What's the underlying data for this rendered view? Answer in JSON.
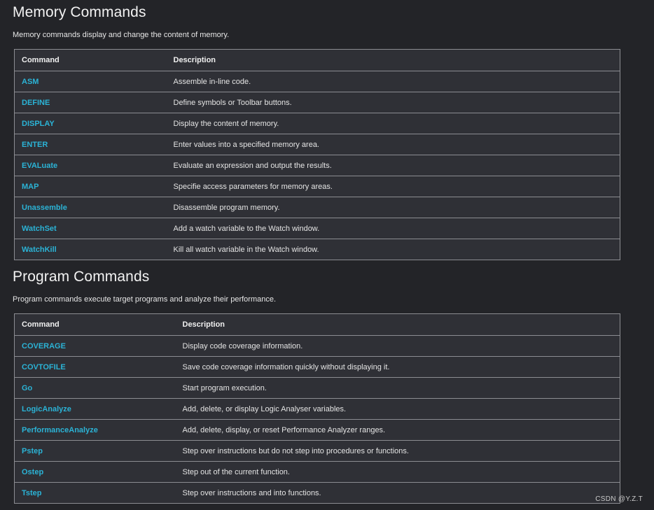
{
  "memory": {
    "title": "Memory Commands",
    "intro": "Memory commands display and change the content of memory.",
    "headers": {
      "command": "Command",
      "description": "Description"
    },
    "rows": [
      {
        "command": "ASM",
        "description": "Assemble in-line code."
      },
      {
        "command": "DEFINE",
        "description": "Define symbols or Toolbar buttons."
      },
      {
        "command": "DISPLAY",
        "description": "Display the content of memory."
      },
      {
        "command": "ENTER",
        "description": "Enter values into a specified memory area."
      },
      {
        "command": "EVALuate",
        "description": "Evaluate an expression and output the results."
      },
      {
        "command": "MAP",
        "description": "Specifie access parameters for memory areas."
      },
      {
        "command": "Unassemble",
        "description": "Disassemble program memory."
      },
      {
        "command": "WatchSet",
        "description": "Add a watch variable to the Watch window."
      },
      {
        "command": "WatchKill",
        "description": "Kill all watch variable in the Watch window."
      }
    ]
  },
  "program": {
    "title": "Program Commands",
    "intro": "Program commands execute target programs and analyze their performance.",
    "headers": {
      "command": "Command",
      "description": "Description"
    },
    "rows": [
      {
        "command": "COVERAGE",
        "description": "Display code coverage information."
      },
      {
        "command": "COVTOFILE",
        "description": "Save code coverage information quickly without displaying it."
      },
      {
        "command": "Go",
        "description": "Start program execution."
      },
      {
        "command": "LogicAnalyze",
        "description": "Add, delete, or display Logic Analyser variables."
      },
      {
        "command": "PerformanceAnalyze",
        "description": "Add, delete, display, or reset Performance Analyzer ranges."
      },
      {
        "command": "Pstep",
        "description": "Step over instructions but do not step into procedures or functions."
      },
      {
        "command": "Ostep",
        "description": "Step out of the current function."
      },
      {
        "command": "Tstep",
        "description": "Step over instructions and into functions."
      }
    ]
  },
  "watermark": "CSDN @Y.Z.T",
  "colors": {
    "background": "#232428",
    "table_background": "#2f3036",
    "border": "#8c8d92",
    "link": "#2bb3d6"
  }
}
